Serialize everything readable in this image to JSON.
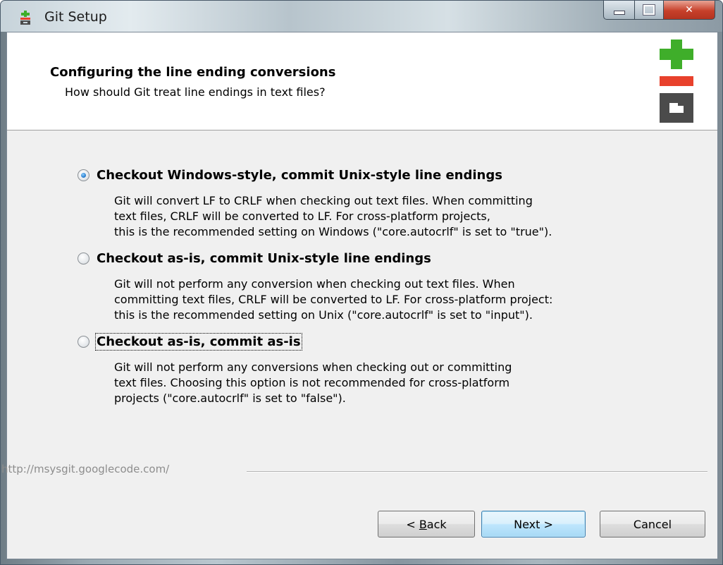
{
  "window": {
    "title": "Git Setup"
  },
  "header": {
    "title": "Configuring the line ending conversions",
    "subtitle": "How should Git treat line endings in text files?"
  },
  "options": [
    {
      "label": "Checkout Windows-style, commit Unix-style line endings",
      "description": "Git will convert LF to CRLF when checking out text files. When committing\ntext files, CRLF will be converted to LF. For cross-platform projects,\nthis is the recommended setting on Windows (\"core.autocrlf\" is set to \"true\").",
      "selected": true
    },
    {
      "label": "Checkout as-is, commit Unix-style line endings",
      "description": "Git will not perform any conversion when checking out text files. When\ncommitting text files, CRLF will be converted to LF. For cross-platform project:\nthis is the recommended setting on Unix (\"core.autocrlf\" is set to \"input\").",
      "selected": false
    },
    {
      "label": "Checkout as-is, commit as-is",
      "description": "Git will not perform any conversions when checking out or committing\ntext files. Choosing this option is not recommended for cross-platform\nprojects (\"core.autocrlf\" is set to \"false\").",
      "selected": false
    }
  ],
  "footer": {
    "link": "http://msysgit.googlecode.com/"
  },
  "buttons": {
    "back_prefix": "< ",
    "back_accel": "B",
    "back_rest": "ack",
    "next": "Next >",
    "cancel": "Cancel"
  },
  "colors": {
    "git_green": "#3fae2a",
    "git_red": "#e8412c",
    "git_gray": "#4b4b4b"
  },
  "icons": {
    "title": "git-setup-icon",
    "logo": "git-logo-icon"
  }
}
